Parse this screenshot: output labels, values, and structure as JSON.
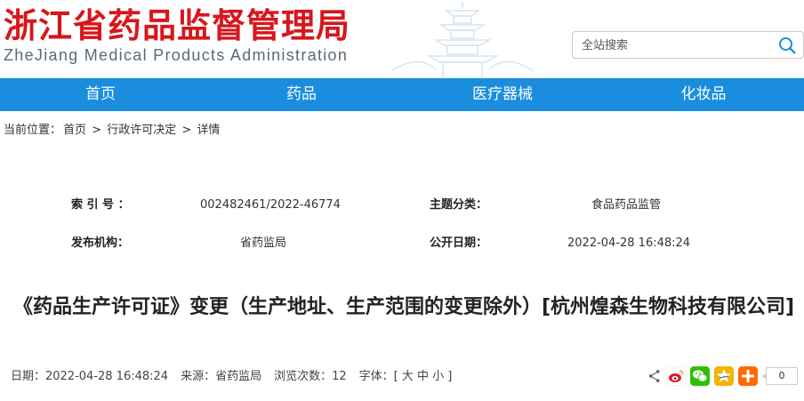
{
  "header": {
    "logo_cn": "浙江省药品监督管理局",
    "logo_en": "ZheJiang Medical Products Administration",
    "search_placeholder": "全站搜索"
  },
  "nav": {
    "items": [
      "首页",
      "药品",
      "医疗器械",
      "化妆品"
    ]
  },
  "breadcrumb": {
    "prefix": "当前位置：",
    "home": "首页",
    "sep1": ">",
    "section": "行政许可决定",
    "sep2": ">",
    "current": "详情"
  },
  "meta": {
    "index_label": "索 引 号 ：",
    "index_value": "002482461/2022-46774",
    "topic_label": "主题分类：",
    "topic_value": "食品药品监管",
    "publisher_label": "发布机构：",
    "publisher_value": "省药监局",
    "date_label": "公开日期：",
    "date_value": "2022-04-28 16:48:24"
  },
  "article": {
    "title": "《药品生产许可证》变更（生产地址、生产范围的变更除外）[杭州煌森生物科技有限公司]"
  },
  "info": {
    "date": "日期：2022-04-28 16:48:24",
    "source": "来源：省药监局",
    "views": "浏览次数：12",
    "font_size": "字体：[ 大 中 小 ]"
  },
  "share": {
    "icons": [
      "share-icon",
      "weibo-icon",
      "wechat-icon",
      "qzone-icon",
      "more-icon"
    ],
    "count": "0",
    "colors": {
      "weibo": "#e6162d",
      "wechat": "#2dc100",
      "qzone": "#f5b400",
      "more": "#ff6a00"
    }
  },
  "colors": {
    "nav_bg": "#1a8ddf",
    "logo_red": "#d7161c"
  }
}
